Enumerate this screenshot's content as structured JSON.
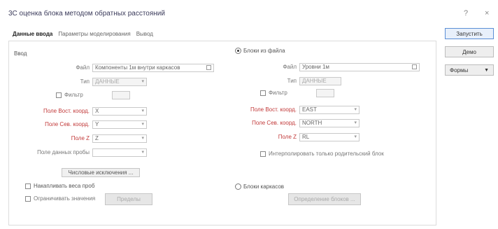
{
  "window": {
    "title": "3С оценка блока методом обратных расстояний",
    "help": "?",
    "close": "×"
  },
  "tabs": [
    {
      "label": "Данные ввода"
    },
    {
      "label": "Параметры моделирования"
    },
    {
      "label": "Вывод"
    }
  ],
  "right": {
    "run": "Запустить",
    "demo": "Демо",
    "forms": "Формы"
  },
  "input": {
    "title": "Ввод",
    "file_label": "Файл",
    "file_value": "Компоненты 1м внутри каркасов",
    "type_label": "Тип",
    "type_value": "ДАННЫЕ",
    "filter_label": "Фильтр",
    "x_label": "Поле Вост. коорд.",
    "x_value": "X",
    "y_label": "Поле Сев. коорд.",
    "y_value": "Y",
    "z_label": "Поле Z",
    "z_value": "Z",
    "grade_label": "Поле данных пробы",
    "exclusions_button": "Числовые исключения ...",
    "accumulate_label": "Накапливать веса проб",
    "limit_label": "Ограничивать значения",
    "limit_button": "Пределы"
  },
  "block": {
    "radio_label": "Блоки из файла",
    "file_label": "Файл",
    "file_value": "Уровни 1м",
    "type_label": "Тип",
    "type_value": "ДАННЫЕ",
    "filter_label": "Фильтр",
    "x_label": "Поле Вост. коорд.",
    "x_value": "EAST",
    "y_label": "Поле Сев. коорд.",
    "y_value": "NORTH",
    "z_label": "Поле Z",
    "z_value": "RL",
    "interp_label": "Интерполировать только родительский блок",
    "carcass_label": "Блоки каркасов",
    "carcass_button": "Определение блоков ..."
  }
}
